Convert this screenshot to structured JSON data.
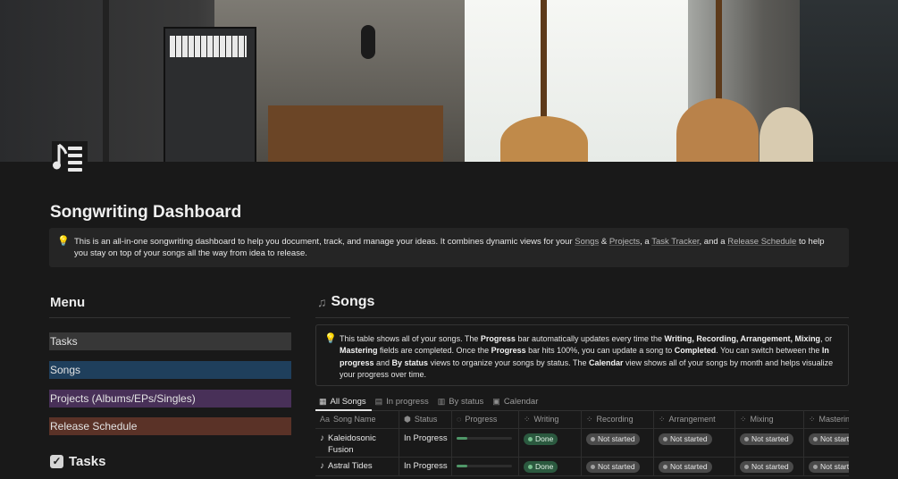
{
  "page": {
    "title": "Songwriting Dashboard",
    "callout": {
      "t1": "This is an all-in-one songwriting dashboard to help you document, track, and manage your ideas. It combines dynamic views for your ",
      "songs_link": "Songs",
      "amp": " & ",
      "projects_link": "Projects",
      "t2": ", a ",
      "task_link": "Task Tracker",
      "t3": ", and a ",
      "release_link": "Release Schedule",
      "t4": " to help you stay on top of your songs all the way from idea to release."
    }
  },
  "menu": {
    "title": "Menu",
    "items": [
      "Tasks",
      "Songs",
      "Projects (Albums/EPs/Singles)",
      "Release Schedule"
    ]
  },
  "tasks": {
    "title": "Tasks"
  },
  "songs": {
    "title": "Songs",
    "callout": {
      "a": "This table shows all of your songs. The ",
      "b": "Progress",
      "c": " bar automatically updates every time the ",
      "d": "Writing, Recording, Arrangement, Mixing",
      "e": ", or ",
      "f": "Mastering",
      "g": " fields are completed. Once the ",
      "h": "Progress",
      "i": " bar hits 100%, you can update a song to ",
      "j": "Completed",
      "k": ". You can switch between the ",
      "l": "In progress",
      "m": " and ",
      "n": "By status",
      "o": " views to organize your songs by status. The ",
      "p": "Calendar",
      "q": " view shows all of your songs by month and helps visualize your progress over time."
    },
    "views": [
      "All Songs",
      "In progress",
      "By status",
      "Calendar"
    ],
    "columns": [
      "Song Name",
      "Status",
      "Progress",
      "Writing",
      "Recording",
      "Arrangement",
      "Mixing",
      "Masterin"
    ],
    "rows": [
      {
        "name": "Kaleidosonic Fusion",
        "status": "In Progress",
        "progress": 0.2,
        "writing": "Done",
        "recording": "Not started",
        "arrangement": "Not started",
        "mixing": "Not started",
        "mastering": "Not start"
      },
      {
        "name": "Astral Tides",
        "status": "In Progress",
        "progress": 0.2,
        "writing": "Done",
        "recording": "Not started",
        "arrangement": "Not started",
        "mixing": "Not started",
        "mastering": "Not start"
      }
    ]
  },
  "icons": {
    "page": "music-list-icon",
    "bulb": "lightbulb-icon",
    "tasks": "checkbox-icon",
    "songs": "music-notes-icon"
  }
}
